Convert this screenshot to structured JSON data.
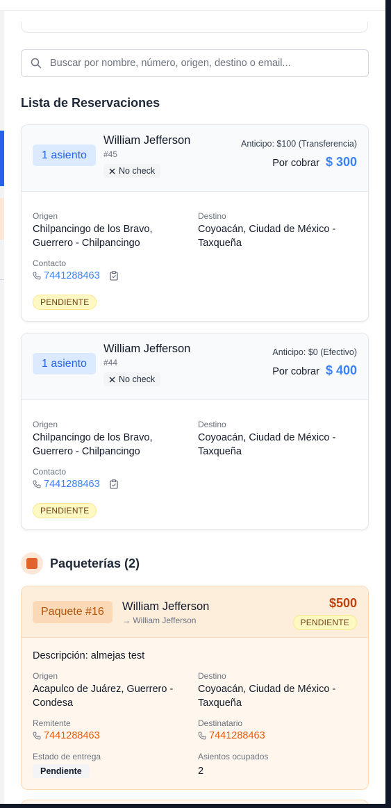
{
  "search": {
    "placeholder": "Buscar por nombre, número, origen, destino o email..."
  },
  "reservations": {
    "title": "Lista de Reservaciones",
    "items": [
      {
        "seats": "1 asiento",
        "name": "William Jefferson",
        "number": "#45",
        "check": "No check",
        "anticipo": "Anticipo: $100 (Transferencia)",
        "por_cobrar_label": "Por cobrar",
        "por_cobrar_amount": "$ 300",
        "origen_label": "Origen",
        "origen_line1": "Chilpancingo de los Bravo,",
        "origen_line2": "Guerrero - Chilpancingo",
        "destino_label": "Destino",
        "destino_line1": "Coyoacán, Ciudad de México -",
        "destino_line2": "Taxqueña",
        "contacto_label": "Contacto",
        "phone": "7441288463",
        "status": "PENDIENTE"
      },
      {
        "seats": "1 asiento",
        "name": "William Jefferson",
        "number": "#44",
        "check": "No check",
        "anticipo": "Anticipo: $0 (Efectivo)",
        "por_cobrar_label": "Por cobrar",
        "por_cobrar_amount": "$ 400",
        "origen_label": "Origen",
        "origen_line1": "Chilpancingo de los Bravo,",
        "origen_line2": "Guerrero - Chilpancingo",
        "destino_label": "Destino",
        "destino_line1": "Coyoacán, Ciudad de México -",
        "destino_line2": "Taxqueña",
        "contacto_label": "Contacto",
        "phone": "7441288463",
        "status": "PENDIENTE"
      }
    ]
  },
  "packages": {
    "title": "Paqueterías (2)",
    "items": [
      {
        "badge": "Paquete #16",
        "name": "William Jefferson",
        "recipient": "→ William Jefferson",
        "price": "$500",
        "status": "PENDIENTE",
        "description": "Descripción: almejas test",
        "origen_label": "Origen",
        "origen_line1": "Acapulco de Juárez, Guerrero -",
        "origen_line2": "Condesa",
        "destino_label": "Destino",
        "destino_line1": "Coyoacán, Ciudad de México -",
        "destino_line2": "Taxqueña",
        "remitente_label": "Remitente",
        "remitente_phone": "7441288463",
        "destinatario_label": "Destinatario",
        "destinatario_phone": "7441288463",
        "estado_label": "Estado de entrega",
        "estado_value": "Pendiente",
        "asientos_label": "Asientos ocupados",
        "asientos_value": "2"
      }
    ]
  },
  "colors": {
    "accent_blue": "#3b82f6",
    "package_orange": "#e2622c",
    "pending_yellow": "#fef9c3"
  },
  "icons": [
    "search-icon",
    "x-icon",
    "phone-icon",
    "clipboard-icon",
    "package-icon"
  ]
}
